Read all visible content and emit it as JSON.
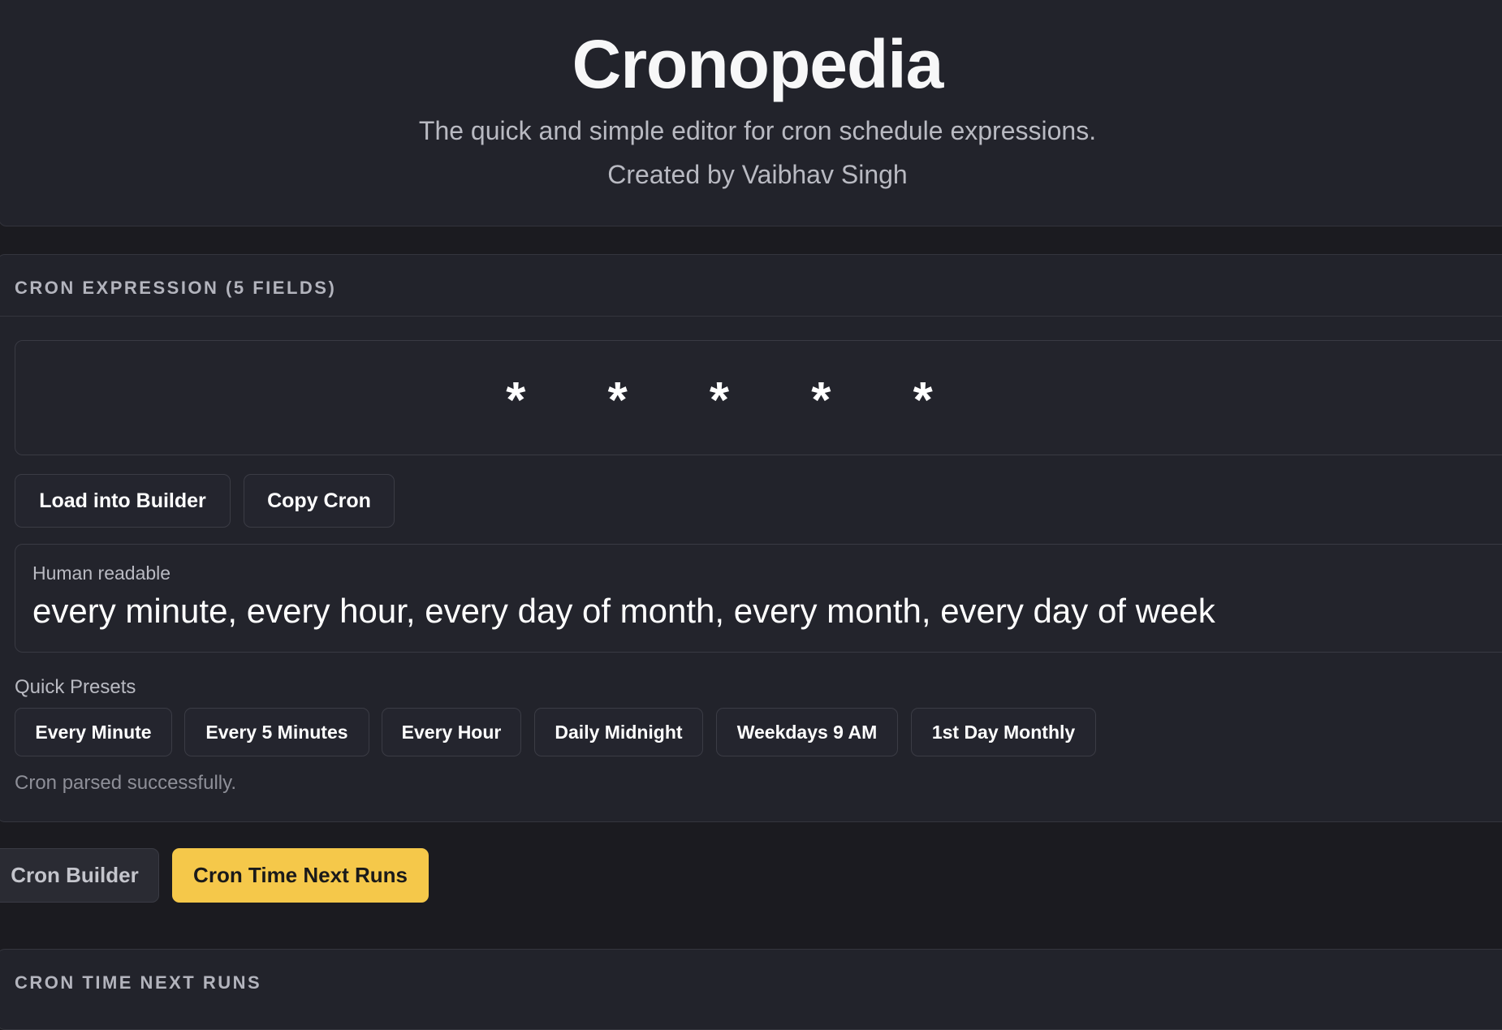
{
  "app": {
    "title": "Cronopedia",
    "subtitle": "The quick and simple editor for cron schedule expressions.",
    "credit": "Created by Vaibhav Singh"
  },
  "expression_panel": {
    "title": "CRON EXPRESSION (5 FIELDS)",
    "expression": "* * * * *",
    "buttons": {
      "load": "Load into Builder",
      "copy": "Copy Cron"
    },
    "human_readable": {
      "label": "Human readable",
      "text": "every minute, every hour, every day of month, every month, every day of week"
    },
    "presets": {
      "label": "Quick Presets",
      "items": [
        "Every Minute",
        "Every 5 Minutes",
        "Every Hour",
        "Daily Midnight",
        "Weekdays 9 AM",
        "1st Day Monthly"
      ]
    },
    "status": "Cron parsed successfully."
  },
  "tabs": {
    "builder": "Cron Builder",
    "next_runs": "Cron Time Next Runs",
    "active": "next_runs"
  },
  "next_runs_panel": {
    "title": "CRON TIME NEXT RUNS"
  },
  "colors": {
    "background": "#1b1b20",
    "panel": "#22232b",
    "accent": "#f5c84a"
  }
}
